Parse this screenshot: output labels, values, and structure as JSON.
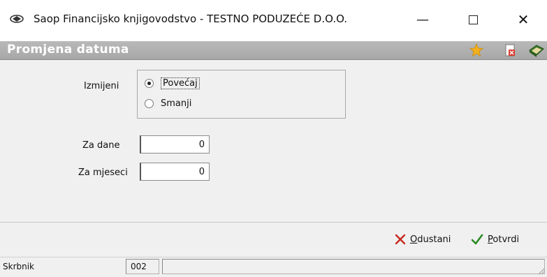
{
  "window": {
    "title": "Saop Financijsko knjigovodstvo - TESTNO PODUZEĆE D.O.O.",
    "minimize_glyph": "—",
    "close_glyph": "✕"
  },
  "header": {
    "title": "Promjena datuma",
    "icons": [
      "favorite-star-icon",
      "close-document-icon",
      "help-book-icon"
    ]
  },
  "form": {
    "change_label": "Izmijeni",
    "options": [
      {
        "label": "Povećaj",
        "checked": true
      },
      {
        "label": "Smanji",
        "checked": false
      }
    ],
    "days_label": "Za dane",
    "days_value": "0",
    "months_label": "Za mjeseci",
    "months_value": "0"
  },
  "actions": {
    "cancel_label": "Odustani",
    "cancel_hotkey": "O",
    "cancel_rest": "dustani",
    "confirm_label": "Potvrdi",
    "confirm_hotkey": "P",
    "confirm_rest": "otvrdi"
  },
  "status": {
    "user": "Skrbnik",
    "code": "002",
    "message": ""
  },
  "colors": {
    "header_bg": "#b0b0b0",
    "content_bg": "#f0f0f0",
    "cancel_x": "#c8281e",
    "confirm_check": "#2a8a22",
    "star": "#f2b01e"
  }
}
